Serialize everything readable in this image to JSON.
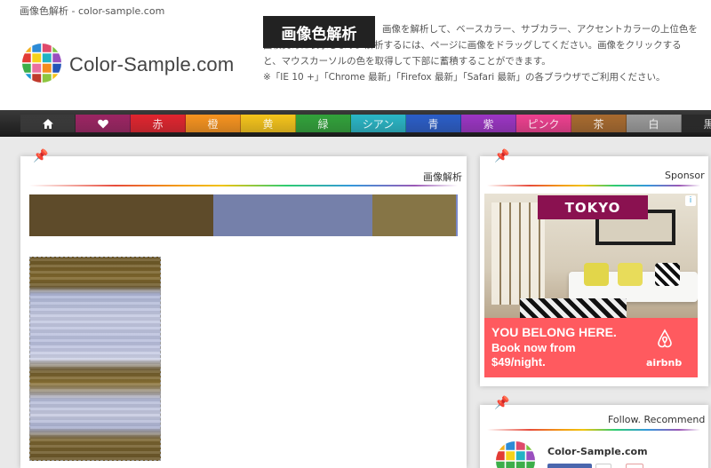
{
  "top_caption": "画像色解析 - color-sample.com",
  "logo_text": "Color-Sample.com",
  "app_title": "画像色解析",
  "description": "画像を解析して、ベースカラー、サブカラー、アクセントカラーの上位色を面積責毎に表示します。解析するには、ページに画像をドラッグしてください。画像をクリックすると、マウスカーソルの色を取得して下部に蓄積することができます。",
  "browser_note": "※「IE 10 +」「Chrome 最新」「Firefox 最新」「Safari 最新」の各ブラウザでご利用ください。",
  "nav": [
    {
      "key": "home",
      "label": "",
      "icon": "home-icon",
      "color": "#3a3a3a"
    },
    {
      "key": "favorite",
      "label": "",
      "icon": "heart-icon",
      "color": "#9c2463"
    },
    {
      "key": "red",
      "label": "赤",
      "color": "#e0242e"
    },
    {
      "key": "orange",
      "label": "橙",
      "color": "#f7931e"
    },
    {
      "key": "yellow",
      "label": "黄",
      "color": "#f5c41a"
    },
    {
      "key": "green",
      "label": "緑",
      "color": "#31a23a"
    },
    {
      "key": "cyan",
      "label": "シアン",
      "color": "#29b6c6"
    },
    {
      "key": "blue",
      "label": "青",
      "color": "#2a5dc8"
    },
    {
      "key": "purple",
      "label": "紫",
      "color": "#9b34c4"
    },
    {
      "key": "pink",
      "label": "ピンク",
      "color": "#ee3f8f"
    },
    {
      "key": "brown",
      "label": "茶",
      "color": "#a86a2e"
    },
    {
      "key": "white",
      "label": "白",
      "color": "#9a9a9a"
    },
    {
      "key": "black",
      "label": "黒",
      "color": "#2a2a2a"
    }
  ],
  "analysis_panel": {
    "title": "画像解析",
    "colors": [
      {
        "hex": "#5e4b2a",
        "fraction": 0.43
      },
      {
        "hex": "#7580aa",
        "fraction": 0.37
      },
      {
        "hex": "#867546",
        "fraction": 0.195
      },
      {
        "hex": "#7a88c8",
        "fraction": 0.005
      }
    ]
  },
  "sponsor_panel": {
    "title": "Sponsor",
    "ad": {
      "tag": "TOKYO",
      "line1": "YOU BELONG HERE.",
      "line2": "Book now from",
      "line3": "$49/night.",
      "brand": "airbnb",
      "colors": {
        "tag": "#8a1150",
        "bottom": "#ff5a5f"
      }
    }
  },
  "follow_panel": {
    "title": "Follow. Recommend",
    "name": "Color-Sample.com"
  }
}
